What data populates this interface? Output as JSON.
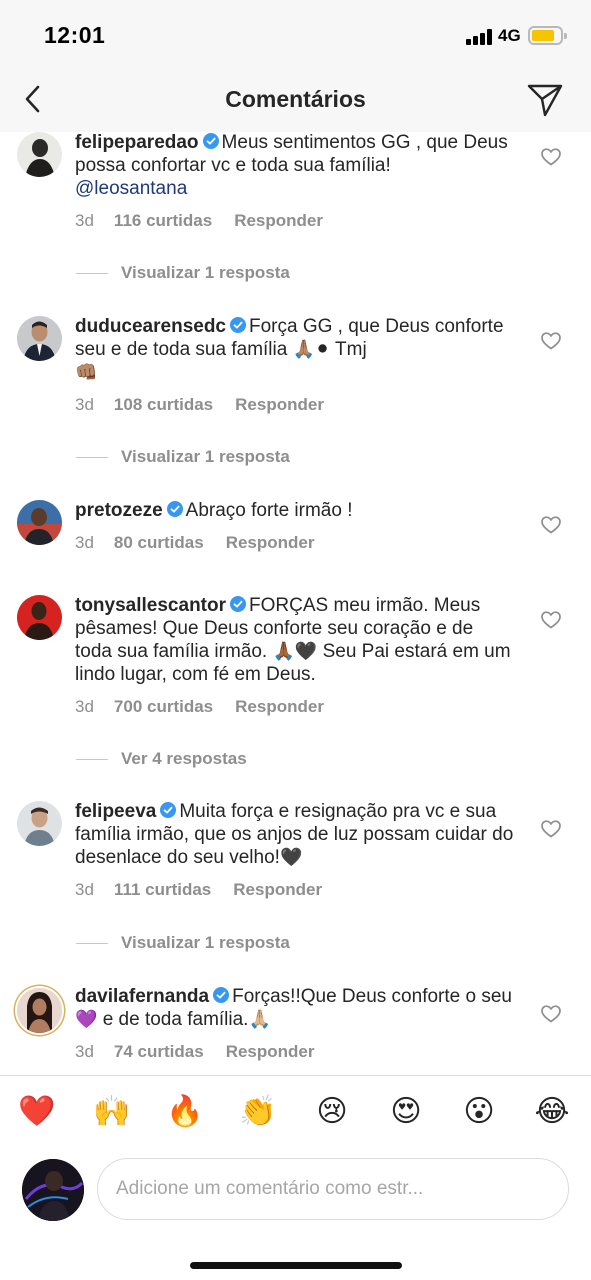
{
  "status_bar": {
    "time": "12:01",
    "network": "4G"
  },
  "header": {
    "title": "Comentários"
  },
  "comments": [
    {
      "username": "felipeparedao",
      "text": "Meus sentimentos GG , que Deus possa confortar vc e toda sua família!",
      "mention": "@leosantana",
      "ago": "3d",
      "likes": "116 curtidas",
      "reply": "Responder",
      "replies_label": "Visualizar 1 resposta"
    },
    {
      "username": "duducearensedc",
      "text": "Força GG , que Deus conforte seu e de toda sua família",
      "emoji_a": "🙏🏽⚫",
      "text_b": "Tmj",
      "emoji_b": "👊🏽",
      "ago": "3d",
      "likes": "108 curtidas",
      "reply": "Responder",
      "replies_label": "Visualizar 1 resposta"
    },
    {
      "username": "pretozeze",
      "text": "Abraço forte irmão !",
      "ago": "3d",
      "likes": "80 curtidas",
      "reply": "Responder"
    },
    {
      "username": "tonysallescantor",
      "text": "FORÇAS meu irmão. Meus pêsames! Que Deus conforte seu coração e de toda sua família irmão.",
      "emoji_a": "🙏🏾🖤",
      "text_b": "Seu Pai estará em um lindo lugar, com fé em Deus.",
      "ago": "3d",
      "likes": "700 curtidas",
      "reply": "Responder",
      "replies_label": "Ver 4 respostas"
    },
    {
      "username": "felipeeva",
      "text": "Muita força e resignação pra vc e sua família irmão, que os anjos de luz possam cuidar do desenlace do seu velho!",
      "emoji_a": "🖤",
      "ago": "3d",
      "likes": "111 curtidas",
      "reply": "Responder",
      "replies_label": "Visualizar 1 resposta"
    },
    {
      "username": "davilafernanda",
      "text": "Forças!!Que Deus conforte o seu",
      "emoji_a": "💜",
      "text_b": "e de toda família.",
      "emoji_b": "🙏🏼",
      "ago": "3d",
      "likes": "74 curtidas",
      "reply": "Responder"
    }
  ],
  "emoji_bar": [
    "❤️",
    "🙌",
    "🔥",
    "👏",
    "😢",
    "😍",
    "😮",
    "😂"
  ],
  "input": {
    "placeholder": "Adicione um comentário como estr..."
  },
  "icons": {
    "back": "chevron-left-icon",
    "send": "paper-plane-icon",
    "verified": "verified-badge-icon",
    "like": "heart-outline-icon"
  },
  "colors": {
    "verified": "#3897f0",
    "mention": "#1e3a7a",
    "muted": "#8e8e8e",
    "battery": "#f6c500"
  }
}
